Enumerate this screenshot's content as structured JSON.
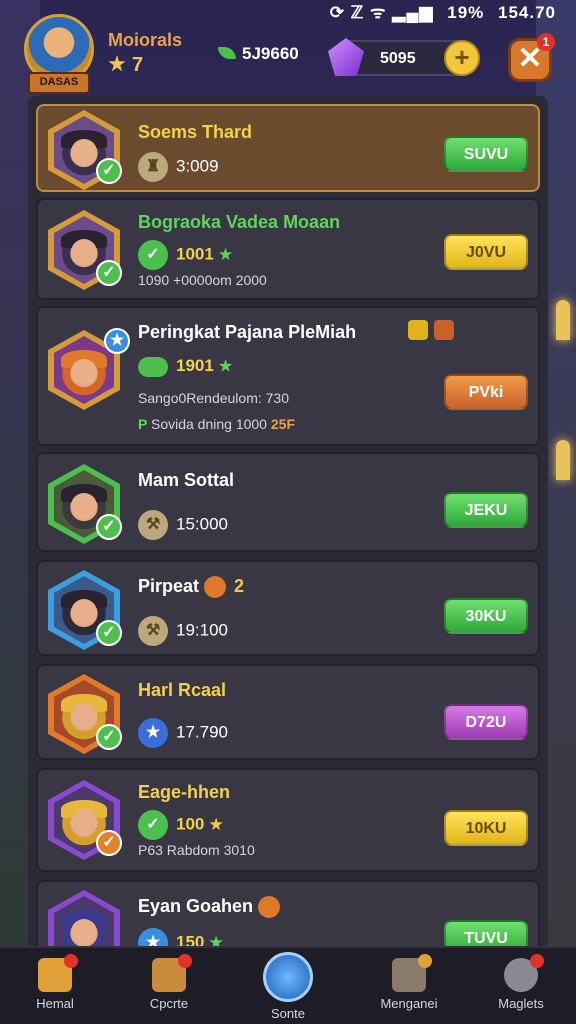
{
  "status_bar": {
    "icons": "⟳ ℤ ᯤ ▂▄▆",
    "battery": "19%",
    "time": "154.70"
  },
  "header": {
    "avatar_tag": "DASAS",
    "player_name": "Moiorals",
    "player_level": "7",
    "gold": "5J9660",
    "gems": "5095",
    "plus": "+",
    "close": "✕",
    "close_badge": "1"
  },
  "cards": [
    {
      "title": "Soems Thard",
      "value": "3:009",
      "button": "SUVU",
      "title_color": "#f3d14a"
    },
    {
      "title": "Bograoka Vadea Moaan",
      "value": "1001",
      "line1": "1090 +0000om 2000",
      "button": "J0VU",
      "title_color": "#5fd45a"
    },
    {
      "title": "Peringkat Pajana PleMiah",
      "value": "1901",
      "line1": "Sango0Rendeulom: 730",
      "line2": "Sovida dning 1000",
      "line2_extra": "25F",
      "button": "PVki"
    },
    {
      "title": "Mam Sottal",
      "value": "15:000",
      "button": "JEKU"
    },
    {
      "title": "Pirpeat",
      "title_badge": "2",
      "value": "19:100",
      "button": "30KU"
    },
    {
      "title": "Harl Rcaal",
      "value": "17.790",
      "button": "D72U",
      "title_color": "#f3d14a"
    },
    {
      "title": "Eage-hhen",
      "value": "100",
      "line1": "P63 Rabdom 3010",
      "button": "10KU",
      "title_color": "#f3d14a"
    },
    {
      "title": "Eyan Goahen",
      "value": "150",
      "button": "TUVU"
    }
  ],
  "nav": [
    {
      "label": "Hemal"
    },
    {
      "label": "Cpcrte"
    },
    {
      "label": "Sonte"
    },
    {
      "label": "Menganei"
    },
    {
      "label": "Maglets"
    }
  ],
  "colors": {
    "accent_gold": "#f3c64f",
    "green": "#2ea83a",
    "yellow": "#e0b417",
    "orange": "#c9622a",
    "purple": "#9e3ab3"
  }
}
